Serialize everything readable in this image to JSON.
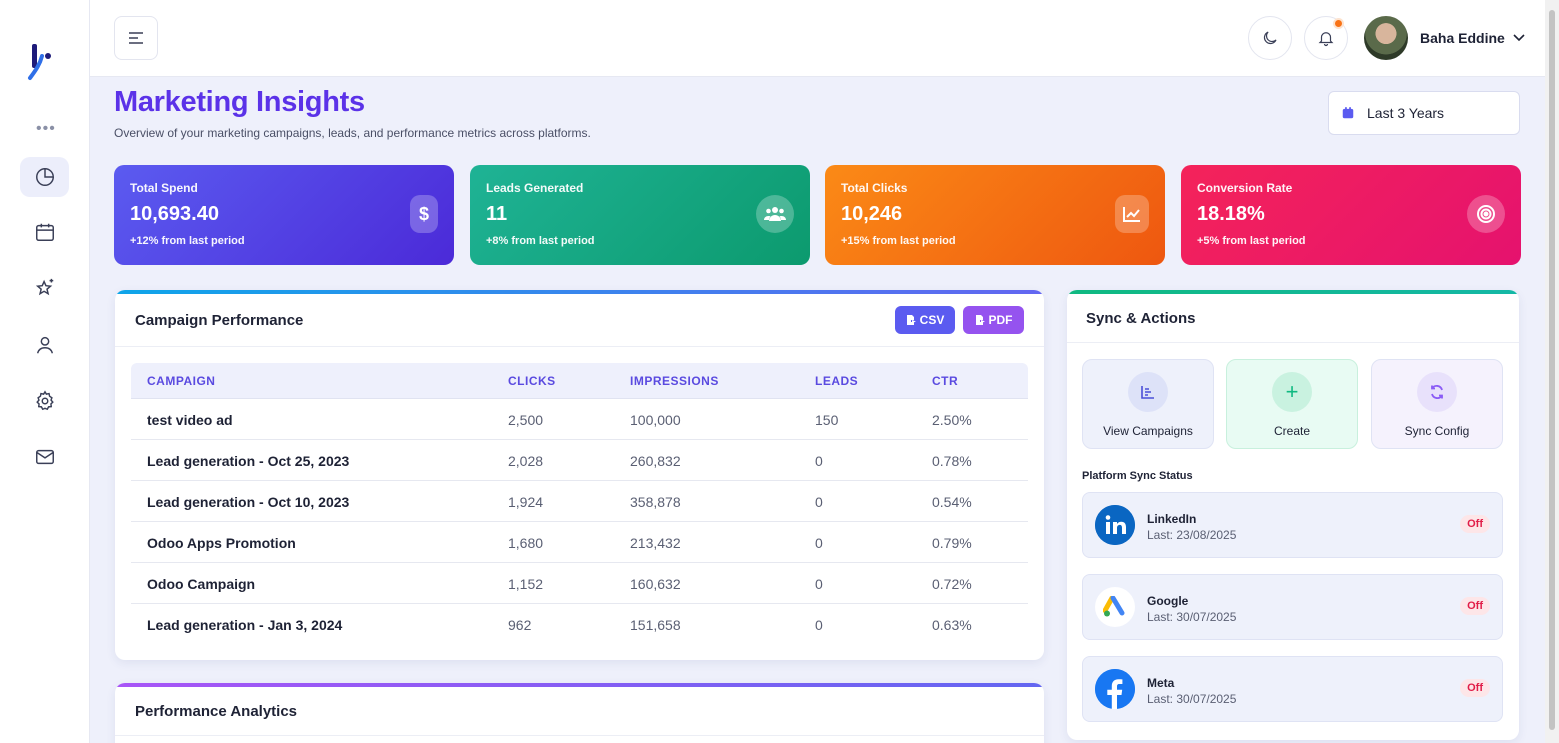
{
  "user": {
    "name": "Baha Eddine"
  },
  "header": {
    "title": "Marketing Insights",
    "subtitle": "Overview of your marketing campaigns, leads, and performance metrics across platforms.",
    "date_range": "Last 3 Years"
  },
  "sidebar": {
    "items": [
      {
        "name": "dashboard",
        "icon": "pie-chart-icon",
        "active": true
      },
      {
        "name": "calendar",
        "icon": "calendar-icon"
      },
      {
        "name": "favorites",
        "icon": "sparkle-star-icon"
      },
      {
        "name": "profile",
        "icon": "user-icon"
      },
      {
        "name": "settings",
        "icon": "gear-icon"
      },
      {
        "name": "messages",
        "icon": "mail-icon"
      }
    ]
  },
  "stats": [
    {
      "label": "Total Spend",
      "value": "10,693.40",
      "delta": "+12% from last period",
      "icon": "dollar-icon",
      "color": "#5b5bf0"
    },
    {
      "label": "Leads Generated",
      "value": "11",
      "delta": "+8% from last period",
      "icon": "users-icon",
      "color": "#1fb395"
    },
    {
      "label": "Total Clicks",
      "value": "10,246",
      "delta": "+15% from last period",
      "icon": "line-chart-icon",
      "color": "#fb8a16"
    },
    {
      "label": "Conversion Rate",
      "value": "18.18%",
      "delta": "+5% from last period",
      "icon": "target-icon",
      "color": "#f4235a"
    }
  ],
  "campaign_panel": {
    "title": "Campaign Performance",
    "csv_label": "CSV",
    "pdf_label": "PDF",
    "columns": [
      "CAMPAIGN",
      "CLICKS",
      "IMPRESSIONS",
      "LEADS",
      "CTR"
    ],
    "rows": [
      [
        "test video ad",
        "2,500",
        "100,000",
        "150",
        "2.50%"
      ],
      [
        "Lead generation - Oct 25, 2023",
        "2,028",
        "260,832",
        "0",
        "0.78%"
      ],
      [
        "Lead generation - Oct 10, 2023",
        "1,924",
        "358,878",
        "0",
        "0.54%"
      ],
      [
        "Odoo Apps Promotion",
        "1,680",
        "213,432",
        "0",
        "0.79%"
      ],
      [
        "Odoo Campaign",
        "1,152",
        "160,632",
        "0",
        "0.72%"
      ],
      [
        "Lead generation - Jan 3, 2024",
        "962",
        "151,658",
        "0",
        "0.63%"
      ]
    ]
  },
  "analytics_panel": {
    "title": "Performance Analytics"
  },
  "sync_panel": {
    "title": "Sync & Actions",
    "actions": [
      {
        "label": "View Campaigns",
        "icon": "list-chart-icon"
      },
      {
        "label": "Create",
        "icon": "plus-icon"
      },
      {
        "label": "Sync Config",
        "icon": "sync-icon"
      }
    ],
    "status_title": "Platform Sync Status",
    "platforms": [
      {
        "name": "LinkedIn",
        "last": "Last: 23/08/2025",
        "status": "Off",
        "icon": "linkedin-icon"
      },
      {
        "name": "Google",
        "last": "Last: 30/07/2025",
        "status": "Off",
        "icon": "google-ads-icon"
      },
      {
        "name": "Meta",
        "last": "Last: 30/07/2025",
        "status": "Off",
        "icon": "facebook-icon"
      }
    ]
  }
}
